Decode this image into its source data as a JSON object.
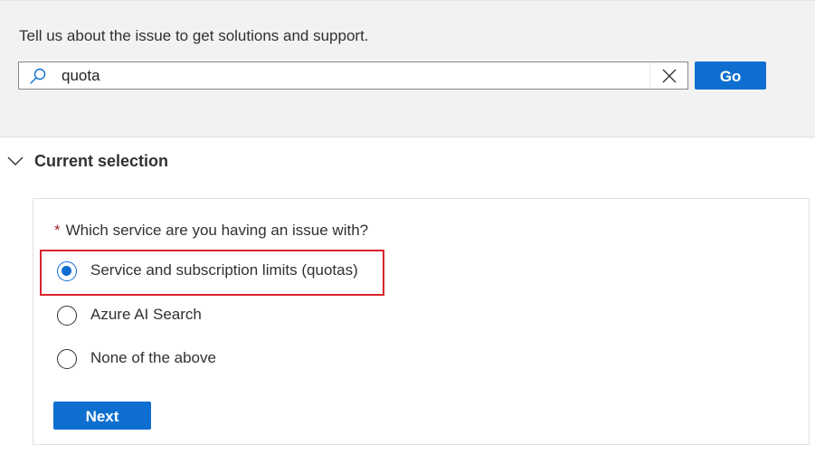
{
  "search": {
    "prompt": "Tell us about the issue to get solutions and support.",
    "value": "quota",
    "go_label": "Go"
  },
  "section": {
    "title": "Current selection"
  },
  "question": {
    "required_marker": "*",
    "text": "Which service are you having an issue with?",
    "options": [
      {
        "label": "Service and subscription limits (quotas)",
        "selected": true
      },
      {
        "label": "Azure AI Search",
        "selected": false
      },
      {
        "label": "None of the above",
        "selected": false
      }
    ]
  },
  "actions": {
    "next_label": "Next"
  },
  "colors": {
    "accent": "#0f6fd0",
    "highlight": "#d9232d",
    "required": "#a4262c",
    "panel_background": "#f2f2f2"
  },
  "icons": [
    "search-icon",
    "close-icon",
    "chevron-down-icon"
  ]
}
